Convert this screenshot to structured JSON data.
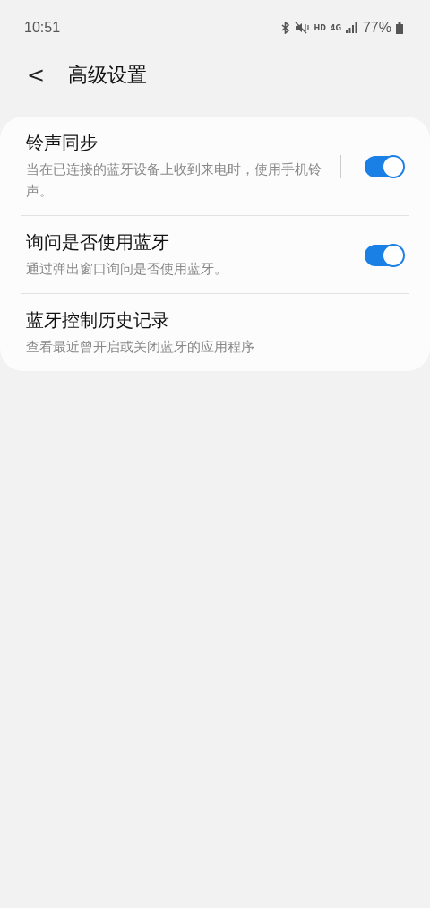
{
  "status_bar": {
    "time": "10:51",
    "hd": "HD",
    "network": "4G",
    "battery": "77%"
  },
  "header": {
    "back": "<",
    "title": "高级设置"
  },
  "settings": [
    {
      "kind": "toggle",
      "title": "铃声同步",
      "summary": "当在已连接的蓝牙设备上收到来电时，使用手机铃声。",
      "separated": true,
      "on": true
    },
    {
      "kind": "toggle",
      "title": "询问是否使用蓝牙",
      "summary": "通过弹出窗口询问是否使用蓝牙。",
      "separated": false,
      "on": true
    },
    {
      "kind": "link",
      "title": "蓝牙控制历史记录",
      "summary": "查看最近曾开启或关闭蓝牙的应用程序"
    }
  ]
}
